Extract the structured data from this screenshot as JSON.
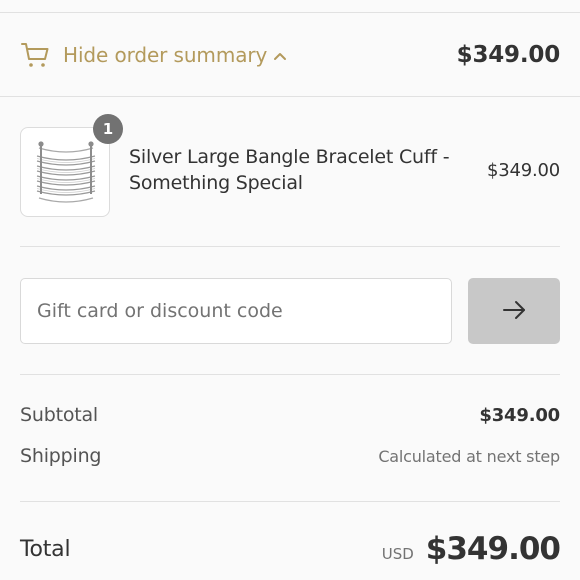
{
  "summary_toggle": {
    "icon": "cart-icon",
    "label": "Hide order summary",
    "chevron_icon": "chevron-up-icon",
    "total": "$349.00",
    "accent_color": "#b39a5c"
  },
  "line_items": [
    {
      "image_icon": "bangle-bracelet-image",
      "quantity": "1",
      "name": "Silver Large Bangle Bracelet Cuff - Something Special",
      "price": "$349.00"
    }
  ],
  "discount": {
    "placeholder": "Gift card or discount code",
    "value": "",
    "submit_icon": "arrow-right-icon"
  },
  "totals": {
    "subtotal_label": "Subtotal",
    "subtotal_value": "$349.00",
    "shipping_label": "Shipping",
    "shipping_value": "Calculated at next step",
    "total_label": "Total",
    "currency": "USD",
    "total_value": "$349.00"
  }
}
